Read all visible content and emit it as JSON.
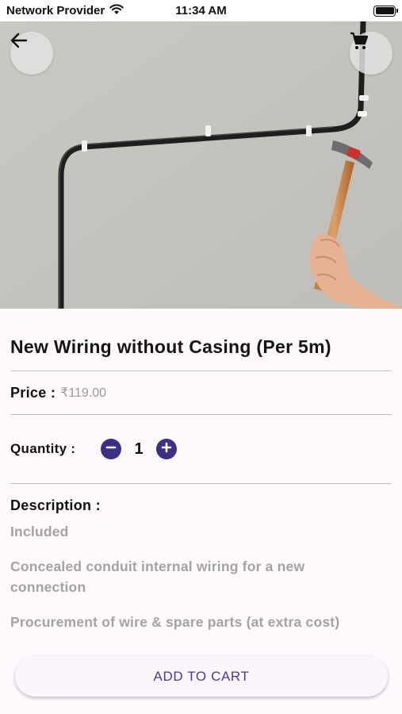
{
  "status_bar": {
    "carrier": "Network Provider",
    "time": "11:34 AM",
    "wifi_icon": "wifi-icon",
    "battery_icon": "battery-icon",
    "battery_level": 1.0
  },
  "header": {
    "back_icon": "arrow-left-icon",
    "cart_icon": "shopping-cart-icon"
  },
  "product": {
    "title": "New Wiring without Casing (Per 5m)",
    "price_label": "Price :",
    "price_value": "₹119.00",
    "quantity_label": "Quantity :",
    "quantity_value": "1",
    "decrease_icon": "minus-icon",
    "increase_icon": "plus-icon",
    "description_label": "Description :",
    "description_items": [
      "Included",
      "Concealed conduit internal wiring for a new connection",
      "Procurement of wire & spare parts (at extra cost)"
    ]
  },
  "actions": {
    "add_to_cart": "ADD TO CART"
  },
  "colors": {
    "accent": "#3b2f86",
    "button_text": "#4a3a8e",
    "muted_text": "#a3a3a3",
    "background": "#fdf9fd"
  }
}
